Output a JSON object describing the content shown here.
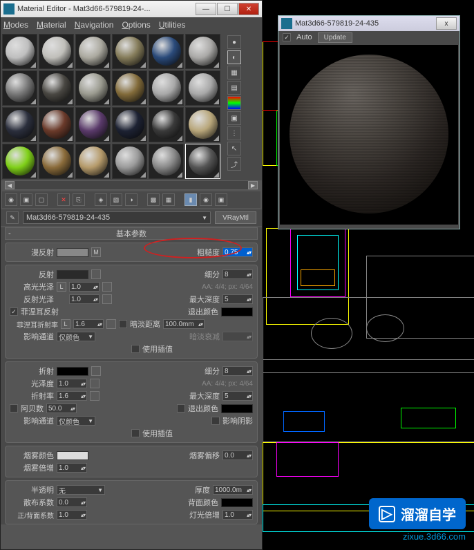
{
  "material_editor": {
    "title": "Material Editor - Mat3d66-579819-24-...",
    "menus": {
      "modes": "Modes",
      "material": "Material",
      "navigation": "Navigation",
      "options": "Options",
      "utilities": "Utilities"
    },
    "material_name": "Mat3d66-579819-24-435",
    "material_type": "VRayMtl",
    "rollout_title": "基本参数",
    "diffuse": {
      "label": "漫反射",
      "map": "M",
      "roughness_label": "粗糙度",
      "roughness": "0.75"
    },
    "reflect": {
      "label": "反射",
      "hilight_gloss": "高光光泽",
      "hilight_val": "1.0",
      "refl_gloss": "反射光泽",
      "refl_val": "1.0",
      "fresnel": "菲涅耳反射",
      "fresnel_ior": "菲涅耳折射率",
      "fresnel_ior_val": "1.6",
      "subdiv_label": "细分",
      "subdiv": "8",
      "aa_label": "AA: 4/4; px: 4/64",
      "max_depth_label": "最大深度",
      "max_depth": "5",
      "exit_color": "退出颜色",
      "dim_dist": "暗淡距离",
      "dim_dist_val": "100.0mm",
      "dim_falloff": "暗淡衰减",
      "affect_channels": "影响通道",
      "affect_val": "仅颜色",
      "use_interp": "使用插值"
    },
    "refract": {
      "label": "折射",
      "glossiness": "光泽度",
      "gloss_val": "1.0",
      "ior": "折射率",
      "ior_val": "1.6",
      "abbe": "阿贝数",
      "abbe_val": "50.0",
      "subdiv_label": "细分",
      "subdiv": "8",
      "aa_label": "AA: 4/4; px: 4/64",
      "max_depth_label": "最大深度",
      "max_depth": "5",
      "exit_color": "退出颜色",
      "affect_shadows": "影响阴影",
      "affect_channels": "影响通道",
      "affect_val": "仅颜色",
      "use_interp": "使用插值"
    },
    "fog": {
      "fog_color": "烟雾颜色",
      "fog_mult": "烟雾倍增",
      "fog_mult_val": "1.0",
      "fog_bias": "烟雾偏移",
      "fog_bias_val": "0.0"
    },
    "sss": {
      "translucency": "半透明",
      "trans_val": "无",
      "scatter": "散布系数",
      "scatter_val": "0.0",
      "fwd_back": "正/背面系数",
      "fb_val": "1.0",
      "thickness": "厚度",
      "thick_val": "1000.0m",
      "back_color": "背面颜色",
      "light_mult": "灯光倍增",
      "light_mult_val": "1.0"
    }
  },
  "preview": {
    "title": "Mat3d66-579819-24-435",
    "auto_label": "Auto",
    "update_label": "Update",
    "close": "x"
  },
  "watermark": {
    "text": "溜溜自学",
    "sub": "zixue.3d66.com"
  },
  "sphere_colors": [
    "#bfbfbf",
    "#c0bfba",
    "#aba99f",
    "#857c5a",
    "#2a4a7a",
    "#aaa9a7",
    "#777",
    "#494742",
    "#9a9a8f",
    "#826b3a",
    "#a8a8a8",
    "#a8a8a8",
    "#2b2f3d",
    "#6a3a2a",
    "#5a3a6a",
    "#1d2233",
    "#3a3a3a",
    "#b8a67a",
    "#7fd018",
    "#8a6b3a",
    "#b59a6a",
    "#9a9a9a",
    "#888",
    "#555"
  ]
}
